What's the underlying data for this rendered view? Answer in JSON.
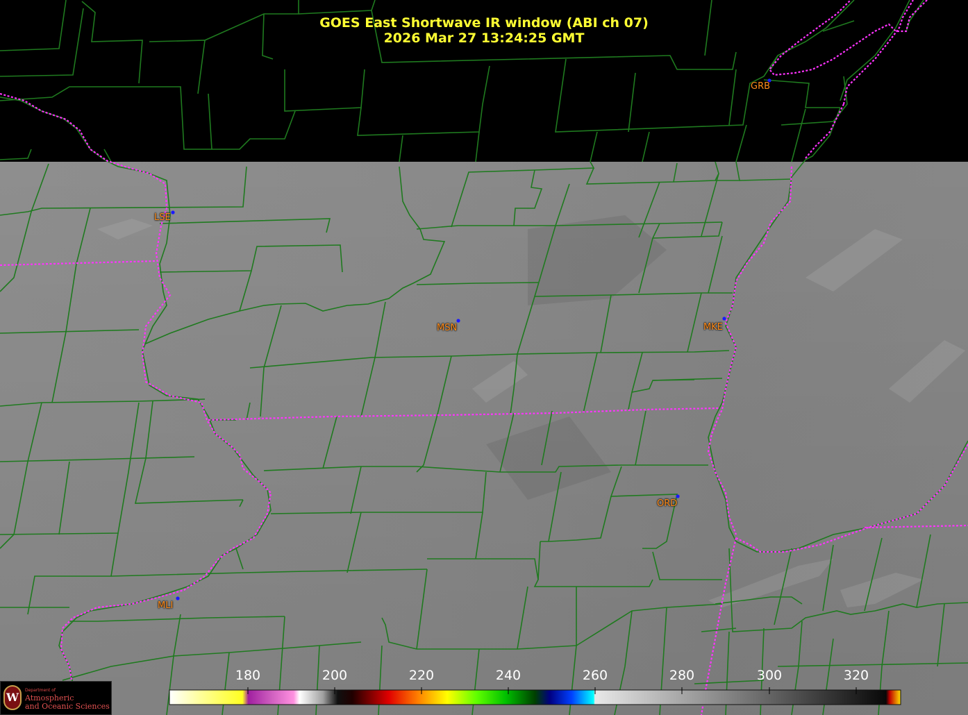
{
  "header": {
    "title": "GOES East Shortwave IR window (ABI ch 07)",
    "timestamp": "2026 Mar 27  13:24:25 GMT"
  },
  "cities": [
    {
      "label": "GRB"
    },
    {
      "label": "LSE"
    },
    {
      "label": "MSN"
    },
    {
      "label": "MKE"
    },
    {
      "label": "ORD"
    },
    {
      "label": "MLI"
    }
  ],
  "colorbar": {
    "ticks": [
      "180",
      "200",
      "220",
      "240",
      "260",
      "280",
      "300",
      "320"
    ]
  },
  "logo": {
    "line1": "Department of",
    "line2": "Atmospheric",
    "line3": "and Oceanic Sciences"
  },
  "colors": {
    "title": "#ffff33",
    "county_lines": "#1f7a1f",
    "state_lines": "#ff33ff",
    "city_labels": "#ff8c1a",
    "city_dots": "#1a1aff"
  }
}
